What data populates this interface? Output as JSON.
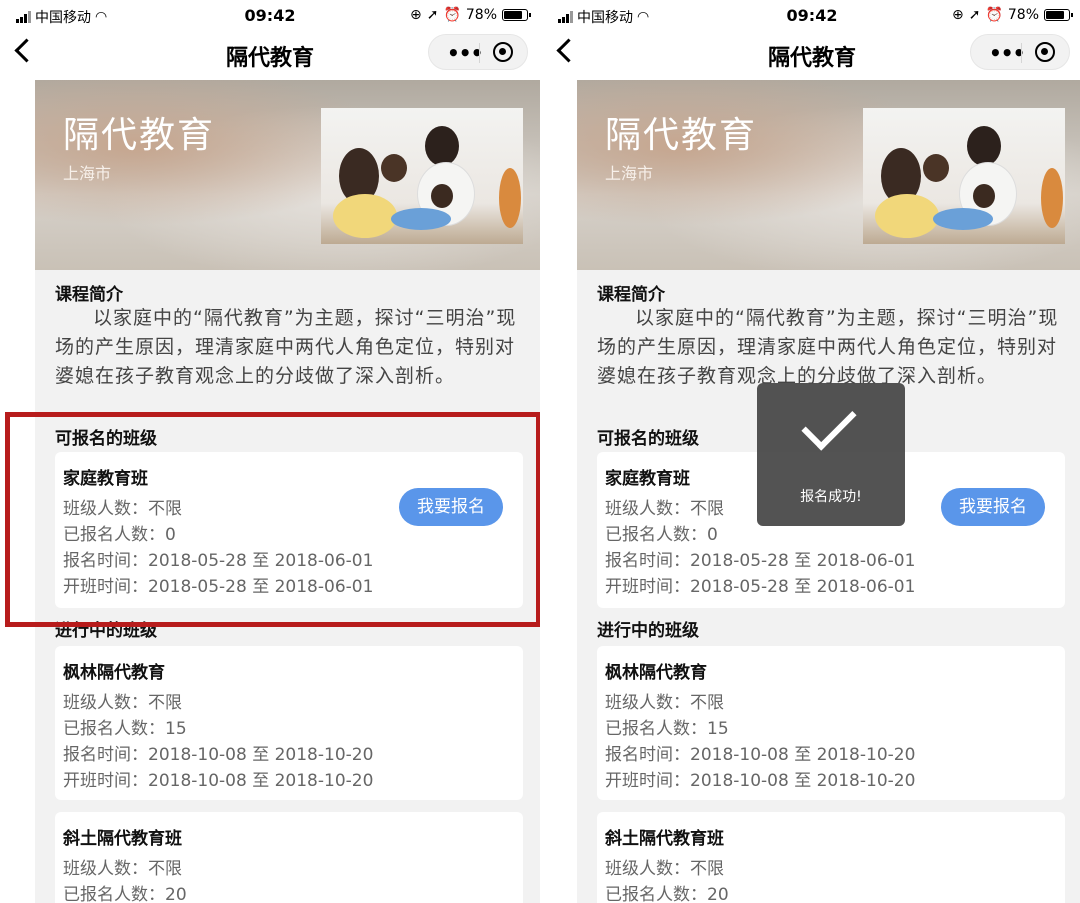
{
  "status_bar": {
    "carrier": "中国移动",
    "time": "09:42",
    "battery": "78%"
  },
  "nav": {
    "title": "隔代教育"
  },
  "banner": {
    "title": "隔代教育",
    "city": "上海市"
  },
  "intro": {
    "heading": "课程简介",
    "text": "以家庭中的“隔代教育”为主题，探讨“三明治”现场的产生原因，理清家庭中两代人角色定位，特别对婆媳在孩子教育观念上的分歧做了深入剖析。"
  },
  "available": {
    "heading": "可报名的班级",
    "classes": [
      {
        "name": "家庭教育班",
        "capacity": "班级人数：不限",
        "enrolled": "已报名人数：0",
        "signup_time": "报名时间：2018-05-28 至 2018-06-01",
        "start_time": "开班时间：2018-05-28 至 2018-06-01",
        "button": "我要报名"
      }
    ]
  },
  "ongoing": {
    "heading": "进行中的班级",
    "classes": [
      {
        "name": "枫林隔代教育",
        "capacity": "班级人数：不限",
        "enrolled": "已报名人数：15",
        "signup_time": "报名时间：2018-10-08 至 2018-10-20",
        "start_time": "开班时间：2018-10-08 至 2018-10-20"
      },
      {
        "name": "斜土隔代教育班",
        "capacity": "班级人数：不限",
        "enrolled": "已报名人数：20"
      }
    ]
  },
  "toast": {
    "text": "报名成功!"
  },
  "colors": {
    "accent": "#5a96ea",
    "highlight_border": "#b71c1c"
  }
}
